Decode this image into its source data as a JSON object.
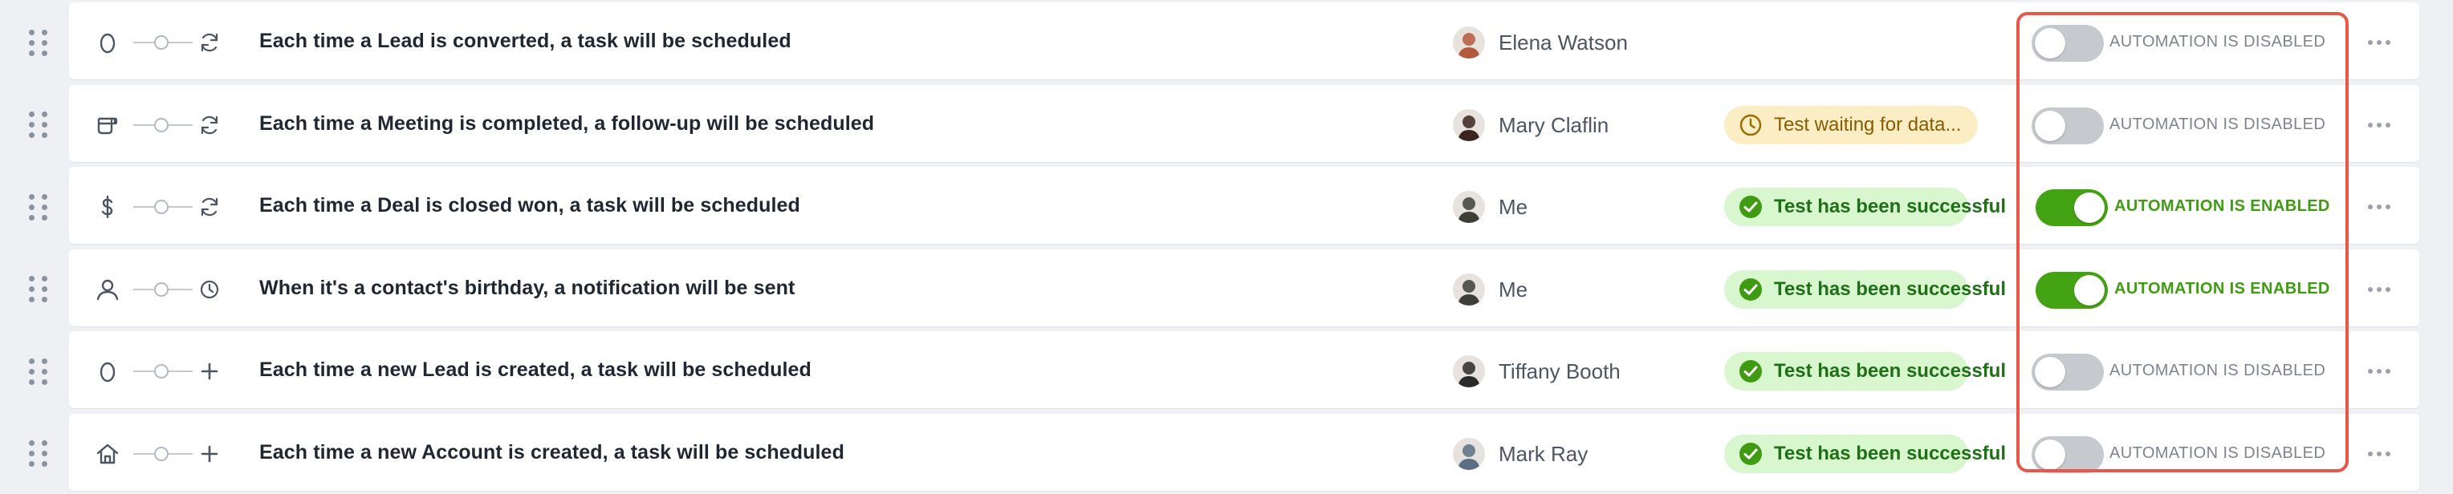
{
  "automations": [
    {
      "trigger_icon": "lead-icon",
      "action_icon": "refresh-icon",
      "title": "Each time a Lead is converted, a task will be scheduled",
      "owner": "Elena Watson",
      "avatar_color": "#b45a3c",
      "test_status": null,
      "test_status_type": null,
      "enabled": false,
      "toggle_label": "AUTOMATION IS DISABLED"
    },
    {
      "trigger_icon": "meeting-icon",
      "action_icon": "refresh-icon",
      "title": "Each time a Meeting is completed, a follow-up will be scheduled",
      "owner": "Mary Claflin",
      "avatar_color": "#3b2420",
      "test_status": "Test waiting for data...",
      "test_status_type": "waiting",
      "enabled": false,
      "toggle_label": "AUTOMATION IS DISABLED"
    },
    {
      "trigger_icon": "dollar-icon",
      "action_icon": "refresh-icon",
      "title": "Each time a Deal is closed won, a task will be scheduled",
      "owner": "Me",
      "avatar_color": "#3d3f36",
      "test_status": "Test has been successful",
      "test_status_type": "success",
      "enabled": true,
      "toggle_label": "AUTOMATION IS ENABLED"
    },
    {
      "trigger_icon": "contact-icon",
      "action_icon": "clock-icon",
      "title": "When it's a contact's birthday, a notification will be sent",
      "owner": "Me",
      "avatar_color": "#3d3f36",
      "test_status": "Test has been successful",
      "test_status_type": "success",
      "enabled": true,
      "toggle_label": "AUTOMATION IS ENABLED"
    },
    {
      "trigger_icon": "lead-icon",
      "action_icon": "plus-icon",
      "title": "Each time a new Lead is created, a task will be scheduled",
      "owner": "Tiffany Booth",
      "avatar_color": "#2a2a2a",
      "test_status": "Test has been successful",
      "test_status_type": "success",
      "enabled": false,
      "toggle_label": "AUTOMATION IS DISABLED"
    },
    {
      "trigger_icon": "account-icon",
      "action_icon": "plus-icon",
      "title": "Each time a new Account is created, a task will be scheduled",
      "owner": "Mark Ray",
      "avatar_color": "#5a6e86",
      "test_status": "Test has been successful",
      "test_status_type": "success",
      "enabled": false,
      "toggle_label": "AUTOMATION IS DISABLED"
    }
  ],
  "colors": {
    "enabled_accent": "#44a312",
    "disabled_toggle": "#c6c9ce",
    "success_badge_bg": "#d8f7cf",
    "waiting_badge_bg": "#fbedc4",
    "highlight_border": "#e8574a"
  }
}
